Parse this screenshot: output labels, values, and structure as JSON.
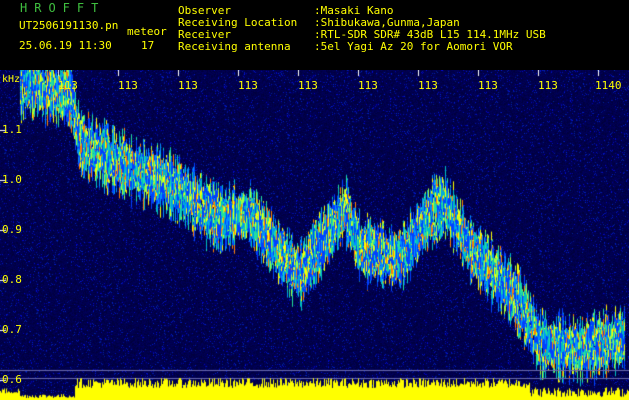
{
  "header": {
    "app_name": "HROFFT",
    "file_name": "UT2506191130.pn",
    "meteor_label": "meteor",
    "date_time": "25.06.19 11:30",
    "count": "17",
    "info": [
      {
        "label": "Observer",
        "value": ":Masaki Kano"
      },
      {
        "label": "Receiving Location",
        "value": ":Shibukawa,Gunma,Japan"
      },
      {
        "label": "Receiver",
        "value": ":RTL-SDR SDR# 43dB L15 114.1MHz USB"
      },
      {
        "label": "Receiving antenna",
        "value": ":5el Yagi Az 20 for Aomori VOR"
      }
    ]
  },
  "axes": {
    "y_unit": "kHz",
    "y_ticks": [
      "1.1",
      "1.0",
      "0.9",
      "0.8",
      "0.7",
      "0.6"
    ],
    "x_ticks": [
      "113",
      "113",
      "113",
      "113",
      "113",
      "113",
      "113",
      "113",
      "113",
      "1140"
    ]
  },
  "colors": {
    "header_text": "#ffff00",
    "title": "#3fbf3f",
    "background_plot": "#000040",
    "tick_marks": "#ffffff"
  }
}
